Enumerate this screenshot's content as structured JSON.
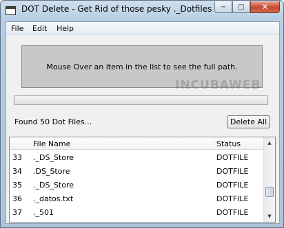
{
  "window": {
    "title": "DOT Delete - Get Rid of those pesky ._Dotfiles",
    "minimize_glyph": "−",
    "maximize_glyph": "□",
    "close_glyph": "✕"
  },
  "menu": [
    "File",
    "Edit",
    "Help"
  ],
  "path_panel": {
    "text": "Mouse Over an item in the list to see the full path."
  },
  "watermark": "INCUBAWEB",
  "progress": {
    "value": 0
  },
  "found_label": "Found 50 Dot Files...",
  "delete_button": "Delete All",
  "list": {
    "columns": [
      "File Name",
      "Status"
    ],
    "rows": [
      {
        "index": "33",
        "name": "._DS_Store",
        "status": "DOTFILE"
      },
      {
        "index": "34",
        "name": ".DS_Store",
        "status": "DOTFILE"
      },
      {
        "index": "35",
        "name": "._DS_Store",
        "status": "DOTFILE"
      },
      {
        "index": "36",
        "name": "._datos.txt",
        "status": "DOTFILE"
      },
      {
        "index": "37",
        "name": "._501",
        "status": "DOTFILE"
      }
    ]
  },
  "scrollbar": {
    "up_glyph": "▲",
    "down_glyph": "▼"
  },
  "colors": {
    "close_button": "#c4472c",
    "path_panel_bg": "#c8c8c8",
    "client_bg": "#f0f0f0"
  }
}
